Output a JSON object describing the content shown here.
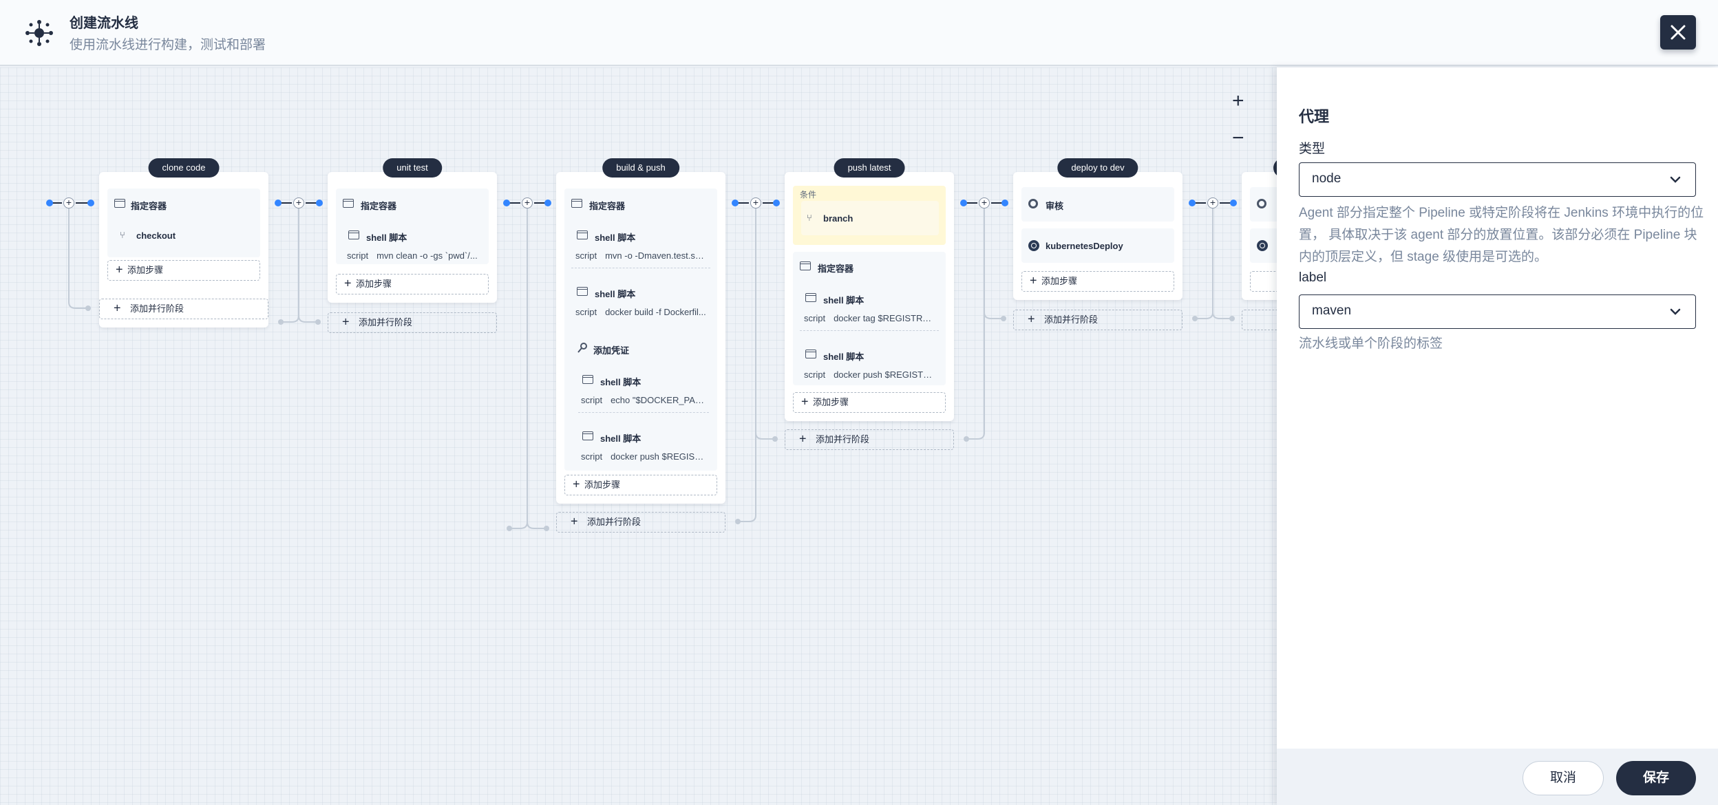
{
  "header": {
    "title": "创建流水线",
    "subtitle": "使用流水线进行构建，测试和部署",
    "logo_icon": "pipeline-icon",
    "close_icon": "close-icon"
  },
  "canvas": {
    "zoom_in": "+",
    "zoom_out": "−",
    "add_step_label": "添加步骤",
    "add_parallel_label": "添加并行阶段",
    "stages": [
      {
        "name": "clone code",
        "steps": [
          {
            "title": "指定容器"
          },
          {
            "title": "checkout"
          }
        ]
      },
      {
        "name": "unit test",
        "steps": [
          {
            "title": "指定容器"
          },
          {
            "title": "shell 脚本",
            "script_key": "script",
            "script": "mvn clean -o -gs `pwd`/..."
          }
        ]
      },
      {
        "name": "build & push",
        "steps": [
          {
            "title": "指定容器"
          },
          {
            "title": "shell 脚本",
            "script_key": "script",
            "script": "mvn -o -Dmaven.test.ski..."
          },
          {
            "title": "shell 脚本",
            "script_key": "script",
            "script": "docker build -f Dockerfil..."
          },
          {
            "title": "添加凭证"
          },
          {
            "title": "shell 脚本",
            "script_key": "script",
            "script": "echo \"$DOCKER_PAS..."
          },
          {
            "title": "shell 脚本",
            "script_key": "script",
            "script": "docker push $REGIST..."
          }
        ]
      },
      {
        "name": "push latest",
        "condition_label": "条件",
        "condition": "branch",
        "steps": [
          {
            "title": "指定容器"
          },
          {
            "title": "shell 脚本",
            "script_key": "script",
            "script": "docker tag $REGISTRY/..."
          },
          {
            "title": "shell 脚本",
            "script_key": "script",
            "script": "docker push $REGISTRY..."
          }
        ]
      },
      {
        "name": "deploy to dev",
        "steps": [
          {
            "title": "审核"
          },
          {
            "title": "kubernetesDeploy"
          }
        ]
      }
    ]
  },
  "panel": {
    "heading": "代理",
    "type_label": "类型",
    "type_value": "node",
    "type_description": "Agent 部分指定整个 Pipeline 或特定阶段将在 Jenkins 环境中执行的位置， 具体取决于该 agent 部分的放置位置。该部分必须在 Pipeline 块内的顶层定义，但 stage 级使用是可选的。",
    "label_label": "label",
    "label_value": "maven",
    "label_description": "流水线或单个阶段的标签",
    "cancel": "取消",
    "save": "保存"
  },
  "colors": {
    "primary": "#242e42",
    "accent_blue": "#3385ff",
    "condition_bg": "#fff8d6",
    "canvas_bg": "#eef2f7"
  }
}
